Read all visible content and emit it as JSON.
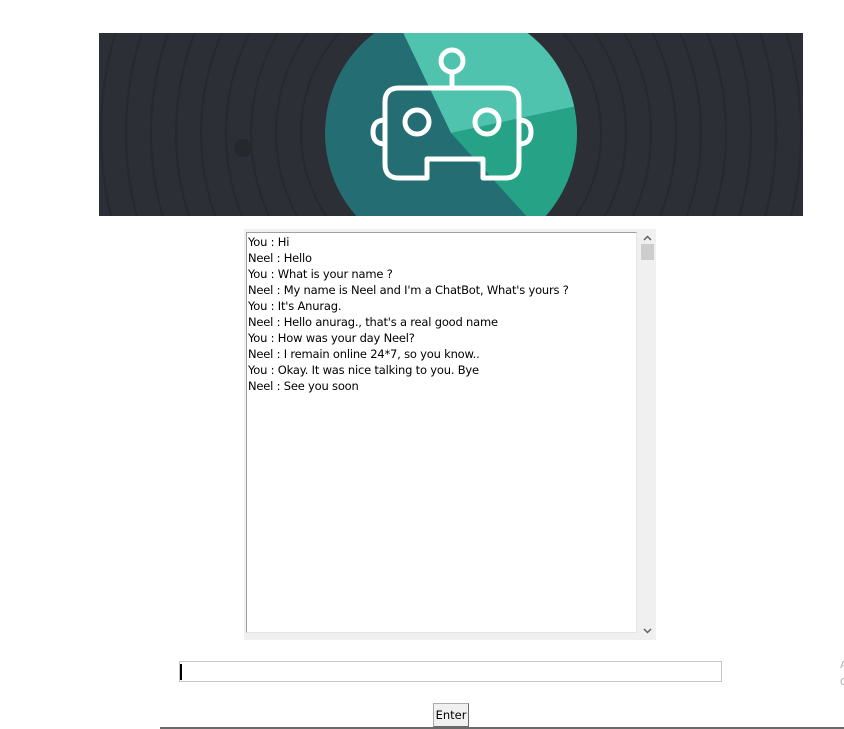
{
  "banner": {
    "image_name": "chatbot-robot-logo",
    "colors": {
      "background": "#2c2f35",
      "circle_dark": "#246d72",
      "circle_light": "#4fc3ad",
      "circle_mid": "#26a386",
      "icon_stroke": "#ffffff"
    }
  },
  "chat": {
    "lines": [
      "You : Hi",
      "Neel : Hello",
      "You : What is your name ?",
      "Neel : My name is Neel and I'm a ChatBot, What's yours ?",
      "You : It's Anurag.",
      "Neel : Hello anurag., that's a real good name",
      "You : How was your day Neel?",
      "Neel : I remain online 24*7, so you know..",
      "You : Okay. It was nice talking to you. Bye",
      "Neel : See you soon"
    ]
  },
  "input": {
    "value": ""
  },
  "buttons": {
    "enter_label": "Enter"
  },
  "edge": {
    "line1": "A",
    "line2": "G"
  }
}
